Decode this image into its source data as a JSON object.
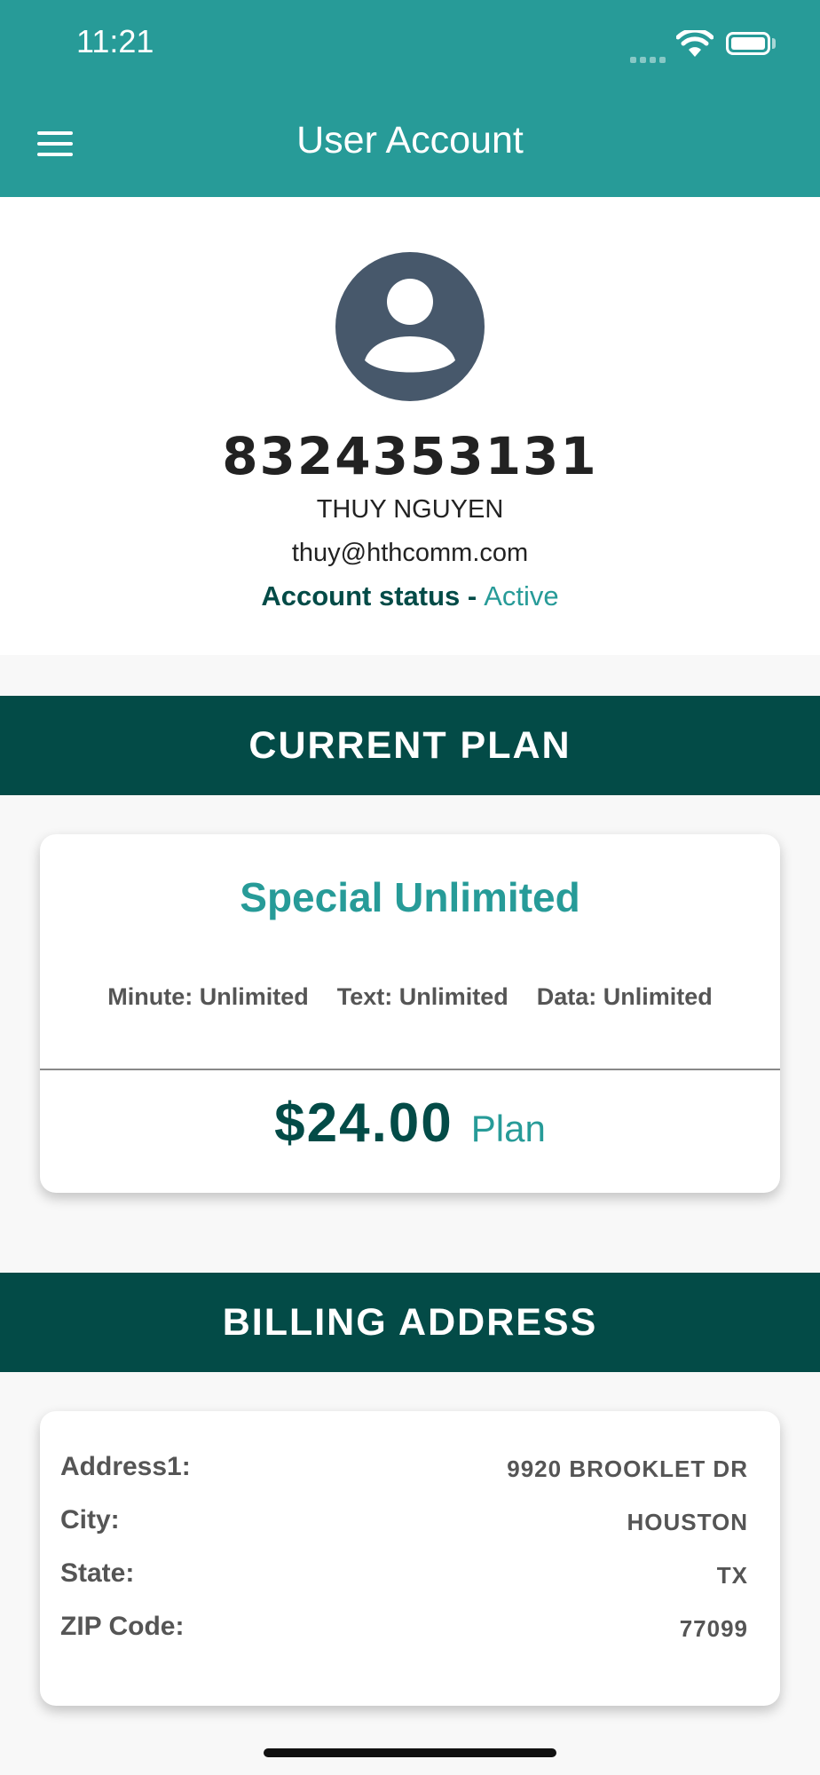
{
  "status_bar": {
    "time": "11:21"
  },
  "nav": {
    "title": "User Account"
  },
  "profile": {
    "phone": "8324353131",
    "name": "THUY NGUYEN",
    "email": "thuy@hthcomm.com",
    "status_label": "Account status -",
    "status_value": "Active"
  },
  "current_plan": {
    "heading": "CURRENT PLAN",
    "name": "Special Unlimited",
    "features": [
      "Minute: Unlimited",
      "Text: Unlimited",
      "Data: Unlimited"
    ],
    "price": "$24.00",
    "price_label": "Plan"
  },
  "billing": {
    "heading": "BILLING ADDRESS",
    "rows": [
      {
        "label": "Address1:",
        "value": "9920 BROOKLET DR"
      },
      {
        "label": "City:",
        "value": "HOUSTON"
      },
      {
        "label": "State:",
        "value": "TX"
      },
      {
        "label": "ZIP Code:",
        "value": "77099"
      }
    ]
  },
  "colors": {
    "header": "#279b98",
    "band": "#034b47",
    "accent": "#279b98",
    "avatar": "#47586b"
  },
  "icons": [
    "menu-icon",
    "avatar-icon",
    "wifi-icon",
    "battery-icon",
    "signal-icon"
  ]
}
